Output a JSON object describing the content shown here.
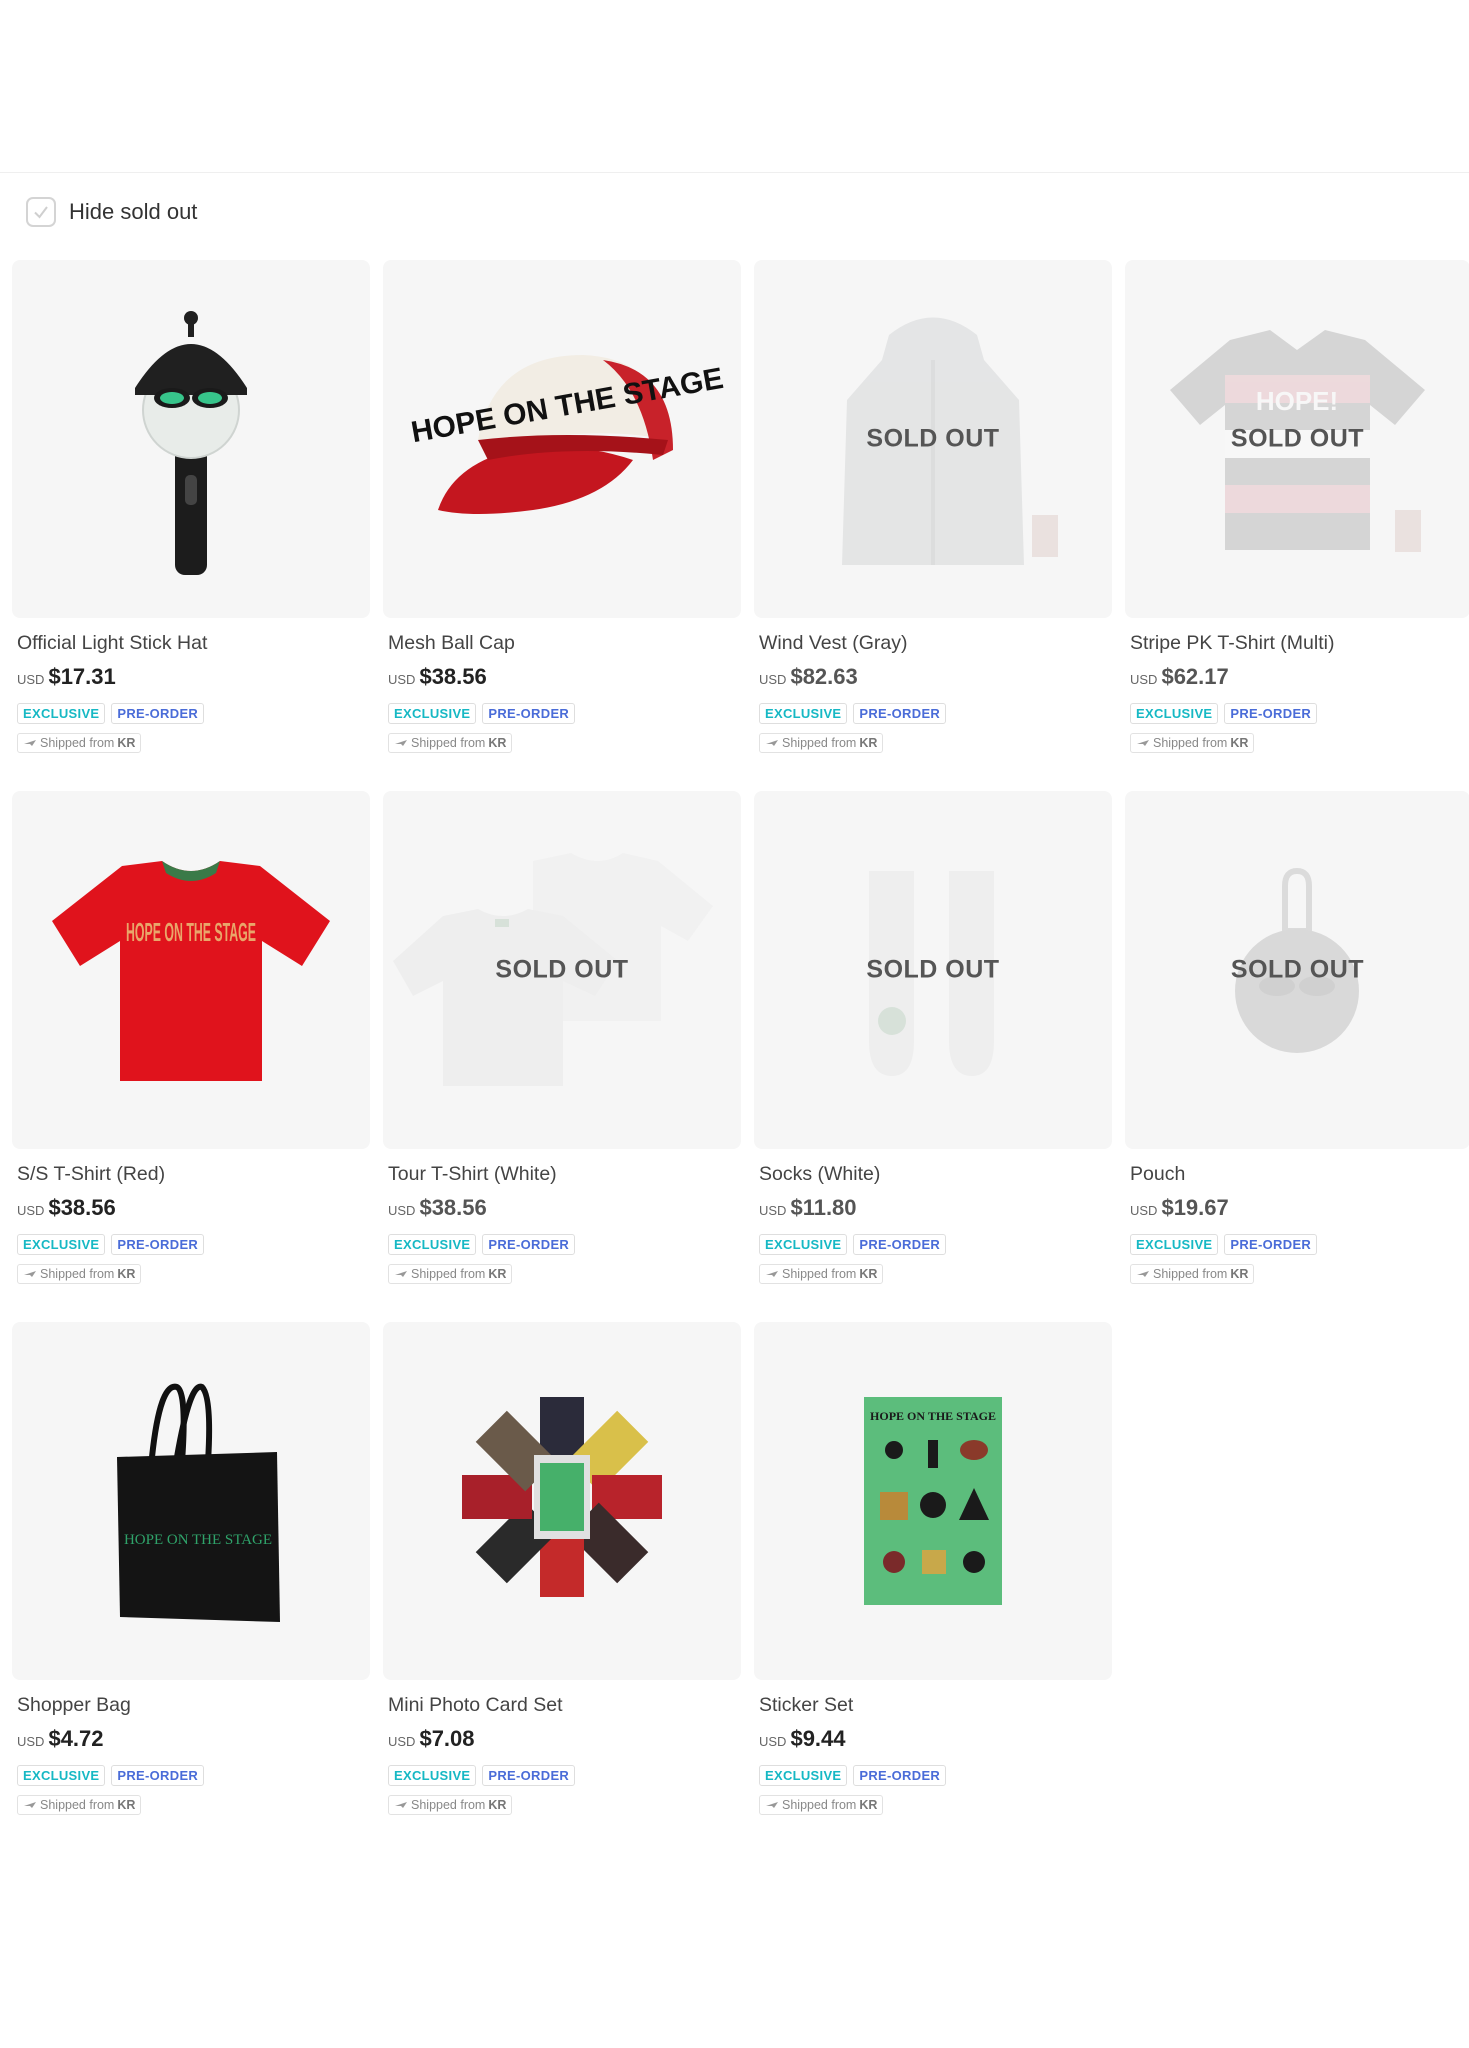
{
  "filter": {
    "label": "Hide sold out"
  },
  "products": [
    {
      "name": "Official Light Stick Hat",
      "currency": "USD",
      "price": "$17.31",
      "tags": [
        "EXCLUSIVE",
        "PRE-ORDER"
      ],
      "shipping": "Shipped from",
      "origin": "KR",
      "sold_out": false
    },
    {
      "name": "Mesh Ball Cap",
      "currency": "USD",
      "price": "$38.56",
      "tags": [
        "EXCLUSIVE",
        "PRE-ORDER"
      ],
      "shipping": "Shipped from",
      "origin": "KR",
      "sold_out": false
    },
    {
      "name": "Wind Vest (Gray)",
      "currency": "USD",
      "price": "$82.63",
      "tags": [
        "EXCLUSIVE",
        "PRE-ORDER"
      ],
      "shipping": "Shipped from",
      "origin": "KR",
      "sold_out": true,
      "sold_out_label": "SOLD OUT"
    },
    {
      "name": "Stripe PK T-Shirt (Multi)",
      "currency": "USD",
      "price": "$62.17",
      "tags": [
        "EXCLUSIVE",
        "PRE-ORDER"
      ],
      "shipping": "Shipped from",
      "origin": "KR",
      "sold_out": true,
      "sold_out_label": "SOLD OUT"
    },
    {
      "name": "S/S T-Shirt (Red)",
      "currency": "USD",
      "price": "$38.56",
      "tags": [
        "EXCLUSIVE",
        "PRE-ORDER"
      ],
      "shipping": "Shipped from",
      "origin": "KR",
      "sold_out": false
    },
    {
      "name": "Tour T-Shirt (White)",
      "currency": "USD",
      "price": "$38.56",
      "tags": [
        "EXCLUSIVE",
        "PRE-ORDER"
      ],
      "shipping": "Shipped from",
      "origin": "KR",
      "sold_out": true,
      "sold_out_label": "SOLD OUT"
    },
    {
      "name": "Socks (White)",
      "currency": "USD",
      "price": "$11.80",
      "tags": [
        "EXCLUSIVE",
        "PRE-ORDER"
      ],
      "shipping": "Shipped from",
      "origin": "KR",
      "sold_out": true,
      "sold_out_label": "SOLD OUT"
    },
    {
      "name": "Pouch",
      "currency": "USD",
      "price": "$19.67",
      "tags": [
        "EXCLUSIVE",
        "PRE-ORDER"
      ],
      "shipping": "Shipped from",
      "origin": "KR",
      "sold_out": true,
      "sold_out_label": "SOLD OUT"
    },
    {
      "name": "Shopper Bag",
      "currency": "USD",
      "price": "$4.72",
      "tags": [
        "EXCLUSIVE",
        "PRE-ORDER"
      ],
      "shipping": "Shipped from",
      "origin": "KR",
      "sold_out": false
    },
    {
      "name": "Mini Photo Card Set",
      "currency": "USD",
      "price": "$7.08",
      "tags": [
        "EXCLUSIVE",
        "PRE-ORDER"
      ],
      "shipping": "Shipped from",
      "origin": "KR",
      "sold_out": false
    },
    {
      "name": "Sticker Set",
      "currency": "USD",
      "price": "$9.44",
      "tags": [
        "EXCLUSIVE",
        "PRE-ORDER"
      ],
      "shipping": "Shipped from",
      "origin": "KR",
      "sold_out": false
    }
  ],
  "product_images": {
    "cap_print": "HOPE ON THE STAGE",
    "tshirt_print": "HOPE ON THE STAGE",
    "polo_print": "HOPE!",
    "bag_print": "HOPE ON THE STAGE",
    "sticker_header": "HOPE ON THE STAGE"
  }
}
